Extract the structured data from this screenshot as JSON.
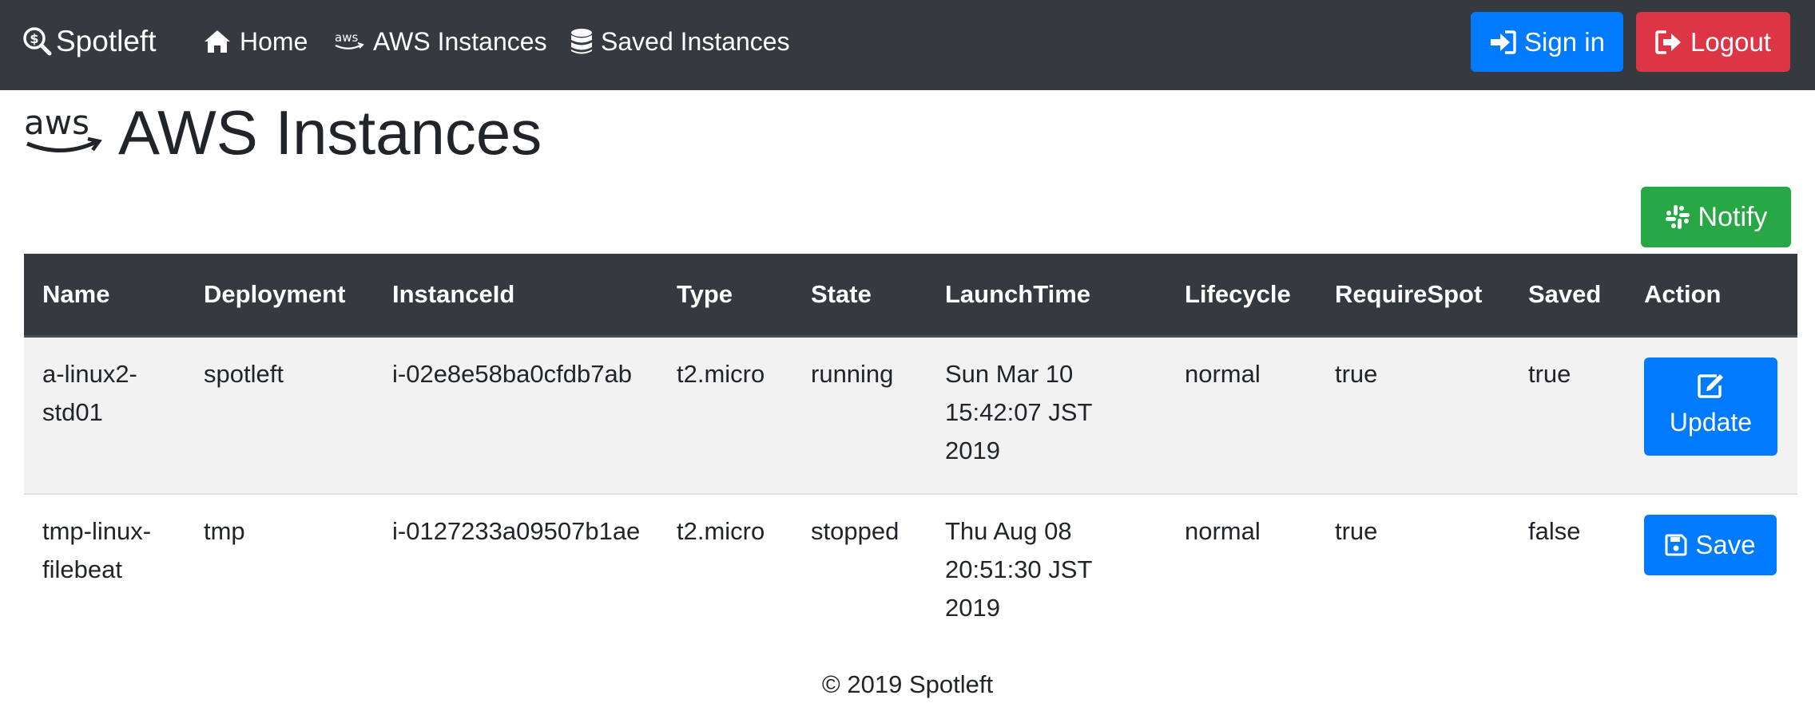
{
  "navbar": {
    "brand": "Spotleft",
    "items": [
      {
        "label": "Home",
        "icon": "home-icon"
      },
      {
        "label": "AWS Instances",
        "icon": "aws-icon"
      },
      {
        "label": "Saved Instances",
        "icon": "database-icon"
      }
    ],
    "signin_label": "Sign in",
    "logout_label": "Logout"
  },
  "page": {
    "title": "AWS Instances",
    "title_icon": "aws-logo-icon",
    "notify_label": "Notify"
  },
  "table": {
    "headers": [
      "Name",
      "Deployment",
      "InstanceId",
      "Type",
      "State",
      "LaunchTime",
      "Lifecycle",
      "RequireSpot",
      "Saved",
      "Action"
    ],
    "rows": [
      {
        "name": "a-linux2-std01",
        "deployment": "spotleft",
        "instance_id": "i-02e8e58ba0cfdb7ab",
        "type": "t2.micro",
        "state": "running",
        "launch_time": "Sun Mar 10 15:42:07 JST 2019",
        "lifecycle": "normal",
        "require_spot": "true",
        "saved": "true",
        "action_label": "Update",
        "action_icon": "edit-icon"
      },
      {
        "name": "tmp-linux-filebeat",
        "deployment": "tmp",
        "instance_id": "i-0127233a09507b1ae",
        "type": "t2.micro",
        "state": "stopped",
        "launch_time": "Thu Aug 08 20:51:30 JST 2019",
        "lifecycle": "normal",
        "require_spot": "true",
        "saved": "false",
        "action_label": "Save",
        "action_icon": "save-icon"
      }
    ]
  },
  "footer": {
    "text": "© 2019 Spotleft"
  },
  "colors": {
    "navbar": "#343a40",
    "primary": "#007bff",
    "danger": "#dc3545",
    "success": "#28a745",
    "striped_row": "#f2f2f2"
  }
}
